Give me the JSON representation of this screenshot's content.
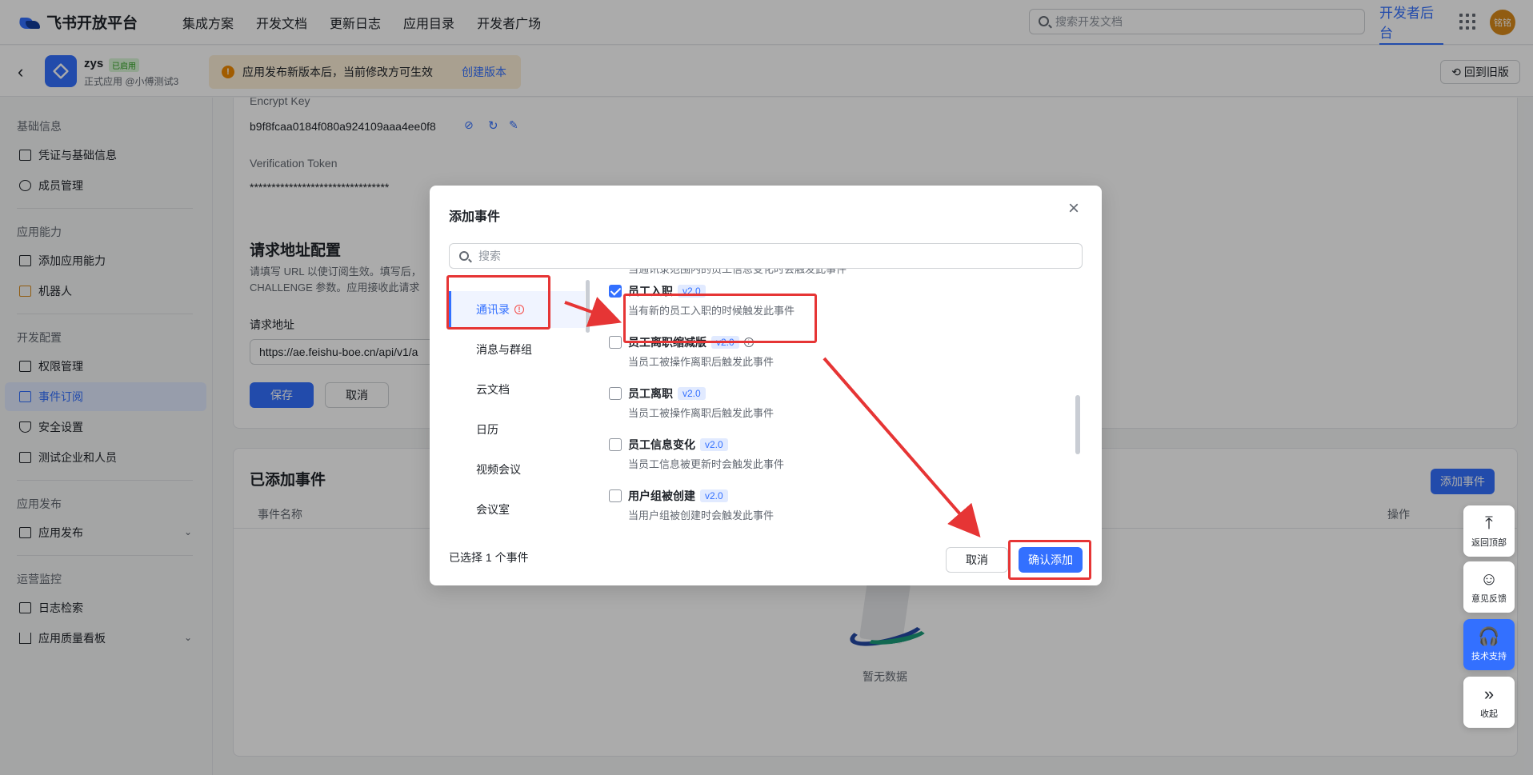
{
  "topbar": {
    "logo_text": "飞书开放平台",
    "nav": [
      "集成方案",
      "开发文档",
      "更新日志",
      "应用目录",
      "开发者广场"
    ],
    "search_placeholder": "搜索开发文档",
    "dev_console": "开发者后台",
    "avatar_text": "铭铭"
  },
  "subbar": {
    "app_name": "zys",
    "app_badge": "已启用",
    "app_sub": "正式应用 @小傅测试3",
    "notice_text": "应用发布新版本后，当前修改方可生效",
    "notice_link": "创建版本",
    "old_version": "回到旧版"
  },
  "sidebar": {
    "groups": [
      {
        "title": "基础信息",
        "items": [
          {
            "label": "凭证与基础信息",
            "icon": "id-card-icon"
          },
          {
            "label": "成员管理",
            "icon": "user-icon"
          }
        ]
      },
      {
        "title": "应用能力",
        "items": [
          {
            "label": "添加应用能力",
            "icon": "apps-icon"
          },
          {
            "label": "机器人",
            "icon": "robot-icon"
          }
        ]
      },
      {
        "title": "开发配置",
        "items": [
          {
            "label": "权限管理",
            "icon": "lock-icon"
          },
          {
            "label": "事件订阅",
            "icon": "event-icon"
          },
          {
            "label": "安全设置",
            "icon": "shield-icon"
          },
          {
            "label": "测试企业和人员",
            "icon": "test-icon"
          }
        ]
      },
      {
        "title": "应用发布",
        "items": [
          {
            "label": "应用发布",
            "icon": "upload-icon"
          }
        ]
      },
      {
        "title": "运营监控",
        "items": [
          {
            "label": "日志检索",
            "icon": "search-log-icon"
          },
          {
            "label": "应用质量看板",
            "icon": "chart-icon"
          }
        ]
      }
    ]
  },
  "main": {
    "encrypt_key_label": "Encrypt Key",
    "encrypt_key_value": "b9f8fcaa0184f080a924109aaa4ee0f8",
    "verification_token_label": "Verification Token",
    "verification_token_value": "********************************",
    "request_section_title": "请求地址配置",
    "request_desc_1": "请填写 URL 以使订阅生效。填写后，",
    "request_desc_2": "CHALLENGE 参数。应用接收此请求",
    "request_url_label": "请求地址",
    "request_url_value": "https://ae.feishu-boe.cn/api/v1/a",
    "save_button": "保存",
    "cancel_button": "取消",
    "added_events_title": "已添加事件",
    "add_event_button": "添加事件",
    "col_event_name": "事件名称",
    "col_actions": "操作",
    "empty_text": "暂无数据"
  },
  "modal": {
    "title": "添加事件",
    "search_placeholder": "搜索",
    "categories": [
      "通讯录",
      "消息与群组",
      "云文档",
      "日历",
      "视频会议",
      "会议室"
    ],
    "events": [
      {
        "name": "员工入职",
        "version": "v2.0",
        "desc": "当有新的员工入职的时候触发此事件",
        "checked": true
      },
      {
        "name": "员工离职缩减版",
        "version": "v2.0",
        "desc": "当员工被操作离职后触发此事件",
        "checked": false,
        "info": true
      },
      {
        "name": "员工离职",
        "version": "v2.0",
        "desc": "当员工被操作离职后触发此事件",
        "checked": false
      },
      {
        "name": "员工信息变化",
        "version": "v2.0",
        "desc": "当员工信息被更新时会触发此事件",
        "checked": false
      },
      {
        "name": "用户组被创建",
        "version": "v2.0",
        "desc": "当用户组被创建时会触发此事件",
        "checked": false
      }
    ],
    "selected_count": "已选择 1 个事件",
    "cancel": "取消",
    "confirm": "确认添加"
  },
  "float_actions": [
    "返回顶部",
    "意见反馈",
    "技术支持",
    "收起"
  ],
  "colors": {
    "accent": "#3370ff",
    "highlight": "#e63535"
  }
}
